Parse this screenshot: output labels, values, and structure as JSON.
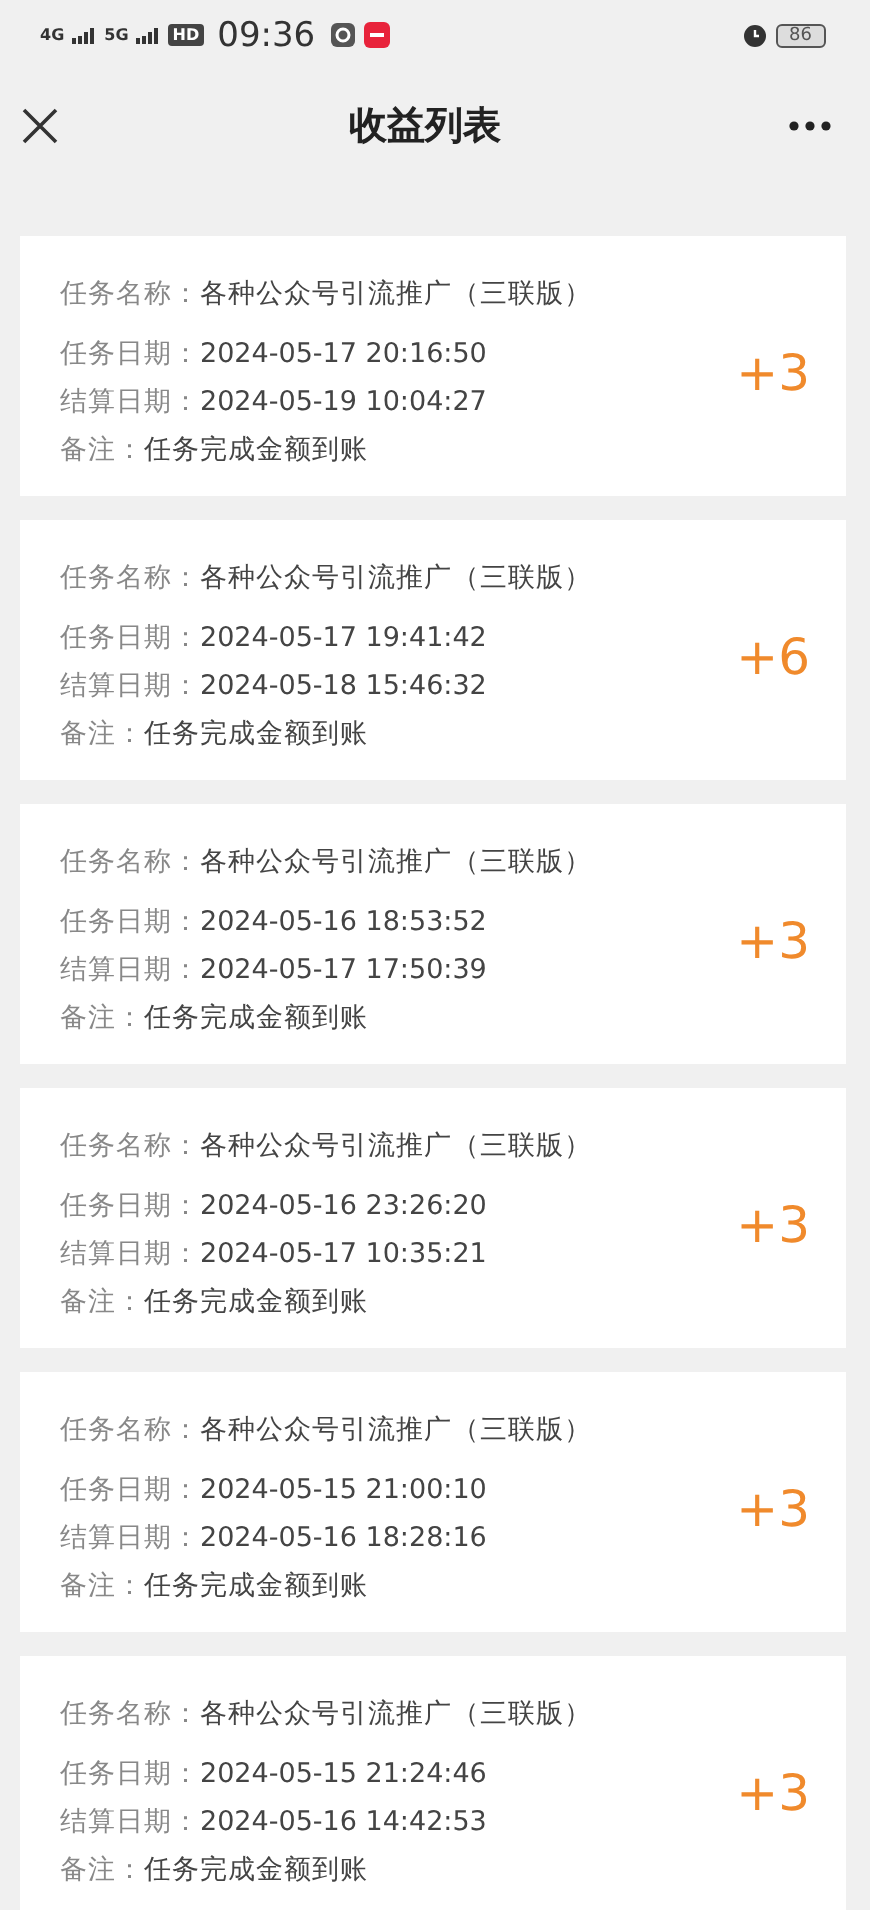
{
  "status_bar": {
    "network_1": "4G",
    "network_2": "5G",
    "hd": "HD",
    "time": "09:36",
    "battery": "86"
  },
  "nav": {
    "title": "收益列表"
  },
  "records": [
    {
      "name": {
        "label": "任务名称：",
        "value": "各种公众号引流推广（三联版）"
      },
      "task_date": {
        "label": "任务日期：",
        "value": "2024-05-17 20:16:50"
      },
      "settle_date": {
        "label": "结算日期：",
        "value": "2024-05-19 10:04:27"
      },
      "note": {
        "label": "备注：",
        "value": "任务完成金额到账"
      },
      "amount": "+3"
    },
    {
      "name": {
        "label": "任务名称：",
        "value": "各种公众号引流推广（三联版）"
      },
      "task_date": {
        "label": "任务日期：",
        "value": "2024-05-17 19:41:42"
      },
      "settle_date": {
        "label": "结算日期：",
        "value": "2024-05-18 15:46:32"
      },
      "note": {
        "label": "备注：",
        "value": "任务完成金额到账"
      },
      "amount": "+6"
    },
    {
      "name": {
        "label": "任务名称：",
        "value": "各种公众号引流推广（三联版）"
      },
      "task_date": {
        "label": "任务日期：",
        "value": "2024-05-16 18:53:52"
      },
      "settle_date": {
        "label": "结算日期：",
        "value": "2024-05-17 17:50:39"
      },
      "note": {
        "label": "备注：",
        "value": "任务完成金额到账"
      },
      "amount": "+3"
    },
    {
      "name": {
        "label": "任务名称：",
        "value": "各种公众号引流推广（三联版）"
      },
      "task_date": {
        "label": "任务日期：",
        "value": "2024-05-16 23:26:20"
      },
      "settle_date": {
        "label": "结算日期：",
        "value": "2024-05-17 10:35:21"
      },
      "note": {
        "label": "备注：",
        "value": "任务完成金额到账"
      },
      "amount": "+3"
    },
    {
      "name": {
        "label": "任务名称：",
        "value": "各种公众号引流推广（三联版）"
      },
      "task_date": {
        "label": "任务日期：",
        "value": "2024-05-15 21:00:10"
      },
      "settle_date": {
        "label": "结算日期：",
        "value": "2024-05-16 18:28:16"
      },
      "note": {
        "label": "备注：",
        "value": "任务完成金额到账"
      },
      "amount": "+3"
    },
    {
      "name": {
        "label": "任务名称：",
        "value": "各种公众号引流推广（三联版）"
      },
      "task_date": {
        "label": "任务日期：",
        "value": "2024-05-15 21:24:46"
      },
      "settle_date": {
        "label": "结算日期：",
        "value": "2024-05-16 14:42:53"
      },
      "note": {
        "label": "备注：",
        "value": "任务完成金额到账"
      },
      "amount": "+3"
    }
  ]
}
